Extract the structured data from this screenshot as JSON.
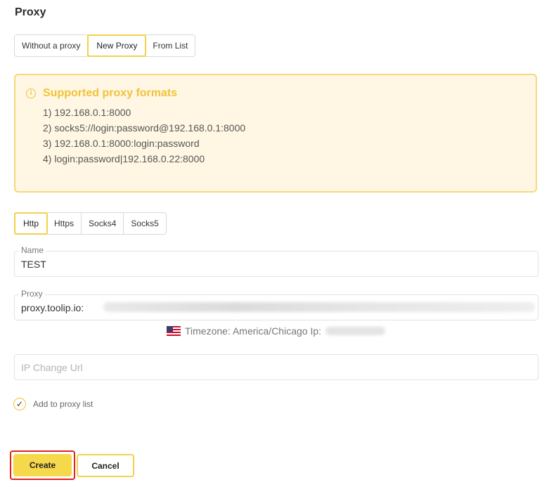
{
  "page": {
    "title": "Proxy"
  },
  "mode_tabs": [
    {
      "label": "Without a proxy",
      "active": false
    },
    {
      "label": "New Proxy",
      "active": true
    },
    {
      "label": "From List",
      "active": false
    }
  ],
  "alert": {
    "icon": "info-circle-icon",
    "heading": "Supported proxy formats",
    "lines": [
      "1) 192.168.0.1:8000",
      "2) socks5://login:password@192.168.0.1:8000",
      "3) 192.168.0.1:8000:login:password",
      "4) login:password|192.168.0.22:8000"
    ],
    "accent_color": "#f2c23a",
    "background_color": "#fff7e3"
  },
  "protocol_tabs": [
    {
      "label": "Http",
      "active": true
    },
    {
      "label": "Https",
      "active": false
    },
    {
      "label": "Socks4",
      "active": false
    },
    {
      "label": "Socks5",
      "active": false
    }
  ],
  "name_field": {
    "label": "Name",
    "value": "TEST"
  },
  "proxy_field": {
    "label": "Proxy",
    "value": "proxy.toolip.io:"
  },
  "timezone": {
    "flag": "us-flag-icon",
    "text": "Timezone: America/Chicago Ip:"
  },
  "ip_change_field": {
    "placeholder": "IP Change Url"
  },
  "add_to_list": {
    "label": "Add to proxy list",
    "checked": true
  },
  "buttons": {
    "create": "Create",
    "cancel": "Cancel"
  },
  "colors": {
    "primary_yellow": "#f6d84b",
    "highlight_red": "#e22020"
  }
}
